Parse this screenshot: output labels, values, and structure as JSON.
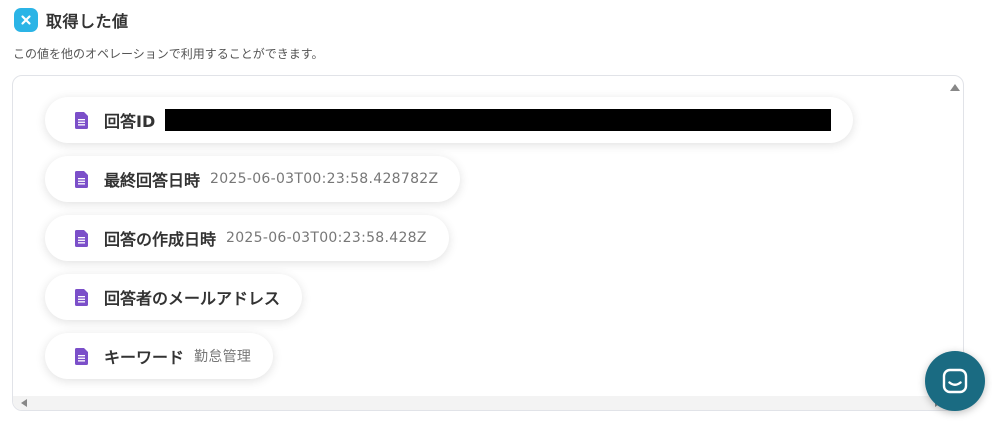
{
  "header": {
    "title": "取得した値",
    "description": "この値を他のオペレーションで利用することができます。"
  },
  "items": [
    {
      "label": "回答ID",
      "value": "",
      "redacted": true
    },
    {
      "label": "最終回答日時",
      "value": "2025-06-03T00:23:58.428782Z"
    },
    {
      "label": "回答の作成日時",
      "value": "2025-06-03T00:23:58.428Z"
    },
    {
      "label": "回答者のメールアドレス",
      "value": ""
    },
    {
      "label": "キーワード",
      "value": "勤怠管理"
    }
  ],
  "colors": {
    "badge": "#2bb4e6",
    "doc_icon": "#7b4fc9",
    "chat_button": "#1a6b82"
  },
  "icons": {
    "badge": "close-badge-icon",
    "item": "document-icon",
    "chat": "chat-icon"
  }
}
